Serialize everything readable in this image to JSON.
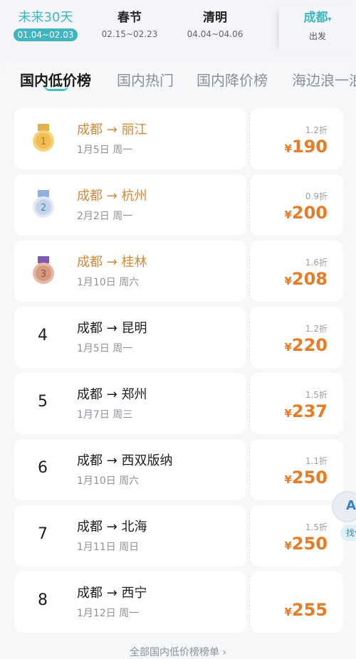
{
  "periods": [
    {
      "name": "未来30天",
      "dates": "01.04~02.03"
    },
    {
      "name": "春节",
      "dates": "02.15~02.23"
    },
    {
      "name": "清明",
      "dates": "04.04~04.06"
    }
  ],
  "departure": {
    "city": "成都",
    "label": "出发"
  },
  "tabs": [
    "国内低价榜",
    "国内热门",
    "国内降价榜",
    "海边浪一浪"
  ],
  "rows": [
    {
      "rank": "1",
      "route": "成都 → 丽江",
      "date": "1月5日 周一",
      "discount": "1.2折",
      "price": "190"
    },
    {
      "rank": "2",
      "route": "成都 → 杭州",
      "date": "2月2日 周一",
      "discount": "0.9折",
      "price": "200"
    },
    {
      "rank": "3",
      "route": "成都 → 桂林",
      "date": "1月10日 周六",
      "discount": "1.6折",
      "price": "208"
    },
    {
      "rank": "4",
      "route": "成都 → 昆明",
      "date": "1月5日 周一",
      "discount": "1.2折",
      "price": "220"
    },
    {
      "rank": "5",
      "route": "成都 → 郑州",
      "date": "1月7日 周三",
      "discount": "1.5折",
      "price": "237"
    },
    {
      "rank": "6",
      "route": "成都 → 西双版纳",
      "date": "1月10日 周六",
      "discount": "1.1折",
      "price": "250"
    },
    {
      "rank": "7",
      "route": "成都 → 北海",
      "date": "1月11日 周日",
      "discount": "1.5折",
      "price": "250"
    },
    {
      "rank": "8",
      "route": "成都 → 西宁",
      "date": "1月12日 周一",
      "discount": "",
      "price": "255"
    }
  ],
  "currency": "¥",
  "footer": "全部国内低价榜榜单 ›",
  "assistant": {
    "badge": "A",
    "label": "找低"
  },
  "colors": {
    "accent": "#3fb6bf",
    "price": "#e77b26",
    "top_route": "#d3893a"
  }
}
